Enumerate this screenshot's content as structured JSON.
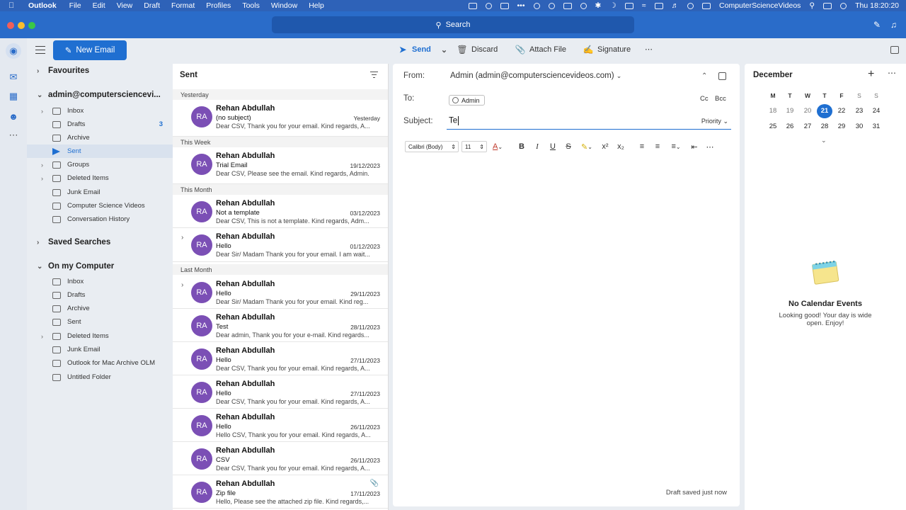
{
  "menubar": {
    "app": "Outlook",
    "items": [
      "File",
      "Edit",
      "View",
      "Draft",
      "Format",
      "Profiles",
      "Tools",
      "Window",
      "Help"
    ],
    "user": "ComputerScienceVideos",
    "clock": "Thu  18:20:20"
  },
  "titlebar": {
    "search_placeholder": "Search"
  },
  "toolbar": {
    "new_email": "New Email",
    "send": "Send",
    "discard": "Discard",
    "attach": "Attach File",
    "signature": "Signature"
  },
  "folders": {
    "favourites": "Favourites",
    "account": "admin@computersciencevi...",
    "account_items": [
      {
        "label": "Inbox",
        "count": ""
      },
      {
        "label": "Drafts",
        "count": "3"
      },
      {
        "label": "Archive",
        "count": ""
      },
      {
        "label": "Sent",
        "count": ""
      },
      {
        "label": "Groups",
        "count": ""
      },
      {
        "label": "Deleted Items",
        "count": ""
      },
      {
        "label": "Junk Email",
        "count": ""
      },
      {
        "label": "Computer Science Videos",
        "count": ""
      },
      {
        "label": "Conversation History",
        "count": ""
      }
    ],
    "saved_searches": "Saved Searches",
    "on_my_computer": "On my Computer",
    "local_items": [
      {
        "label": "Inbox"
      },
      {
        "label": "Drafts"
      },
      {
        "label": "Archive"
      },
      {
        "label": "Sent"
      },
      {
        "label": "Deleted Items"
      },
      {
        "label": "Junk Email"
      },
      {
        "label": "Outlook for Mac Archive OLM"
      },
      {
        "label": "Untitled Folder"
      }
    ]
  },
  "message_list": {
    "title": "Sent",
    "groups": [
      "Yesterday",
      "This Week",
      "This Month",
      "Last Month"
    ],
    "messages": [
      {
        "initials": "RA",
        "from": "Rehan Abdullah",
        "subject": "(no subject)",
        "date": "Yesterday",
        "preview": "Dear CSV, Thank you for your email. Kind regards, A..."
      },
      {
        "initials": "RA",
        "from": "Rehan Abdullah",
        "subject": "Trial Email",
        "date": "19/12/2023",
        "preview": "Dear CSV, Please see the email. Kind regards, Admin."
      },
      {
        "initials": "RA",
        "from": "Rehan Abdullah",
        "subject": "Not a template",
        "date": "03/12/2023",
        "preview": "Dear CSV, This is not a template. Kind regards, Adm..."
      },
      {
        "initials": "RA",
        "from": "Rehan Abdullah",
        "subject": "Hello",
        "date": "01/12/2023",
        "preview": "Dear Sir/ Madam Thank you for your email. I am wait..."
      },
      {
        "initials": "RA",
        "from": "Rehan Abdullah",
        "subject": "Hello",
        "date": "29/11/2023",
        "preview": "Dear Sir/ Madam Thank you for your email. Kind reg..."
      },
      {
        "initials": "RA",
        "from": "Rehan Abdullah",
        "subject": "Test",
        "date": "28/11/2023",
        "preview": "Dear admin, Thank you for your e-mail. Kind regards..."
      },
      {
        "initials": "RA",
        "from": "Rehan Abdullah",
        "subject": "Hello",
        "date": "27/11/2023",
        "preview": "Dear CSV, Thank you for your email. Kind regards, A..."
      },
      {
        "initials": "RA",
        "from": "Rehan Abdullah",
        "subject": "Hello",
        "date": "27/11/2023",
        "preview": "Dear CSV, Thank you for your email. Kind regards, A..."
      },
      {
        "initials": "RA",
        "from": "Rehan Abdullah",
        "subject": "Hello",
        "date": "26/11/2023",
        "preview": "Hello CSV, Thank you for your email. Kind regards, A..."
      },
      {
        "initials": "RA",
        "from": "Rehan Abdullah",
        "subject": "CSV",
        "date": "26/11/2023",
        "preview": "Dear CSV, Thank you for your email. Kind regards, A..."
      },
      {
        "initials": "RA",
        "from": "Rehan Abdullah",
        "subject": "Zip file",
        "date": "17/11/2023",
        "preview": "Hello, Please see the attached zip file. Kind regards,..."
      }
    ]
  },
  "compose": {
    "from_label": "From:",
    "from_value": "Admin (admin@computersciencevideos.com)",
    "to_label": "To:",
    "to_chip": "Admin",
    "cc": "Cc",
    "bcc": "Bcc",
    "subject_label": "Subject:",
    "subject_value": "Te",
    "priority": "Priority",
    "font": "Calibri (Body)",
    "size": "11",
    "status": "Draft saved just now"
  },
  "calendar": {
    "month": "December",
    "dow": [
      "M",
      "T",
      "W",
      "T",
      "F",
      "S",
      "S"
    ],
    "week1": [
      "18",
      "19",
      "20",
      "21",
      "22",
      "23",
      "24"
    ],
    "week2": [
      "25",
      "26",
      "27",
      "28",
      "29",
      "30",
      "31"
    ],
    "today": "21",
    "empty_title": "No Calendar Events",
    "empty_msg": "Looking good! Your day is wide open. Enjoy!"
  },
  "colors": {
    "accent": "#1f6fd1",
    "titlebar": "#2a6cc9",
    "avatar": "#7b4fb5"
  }
}
